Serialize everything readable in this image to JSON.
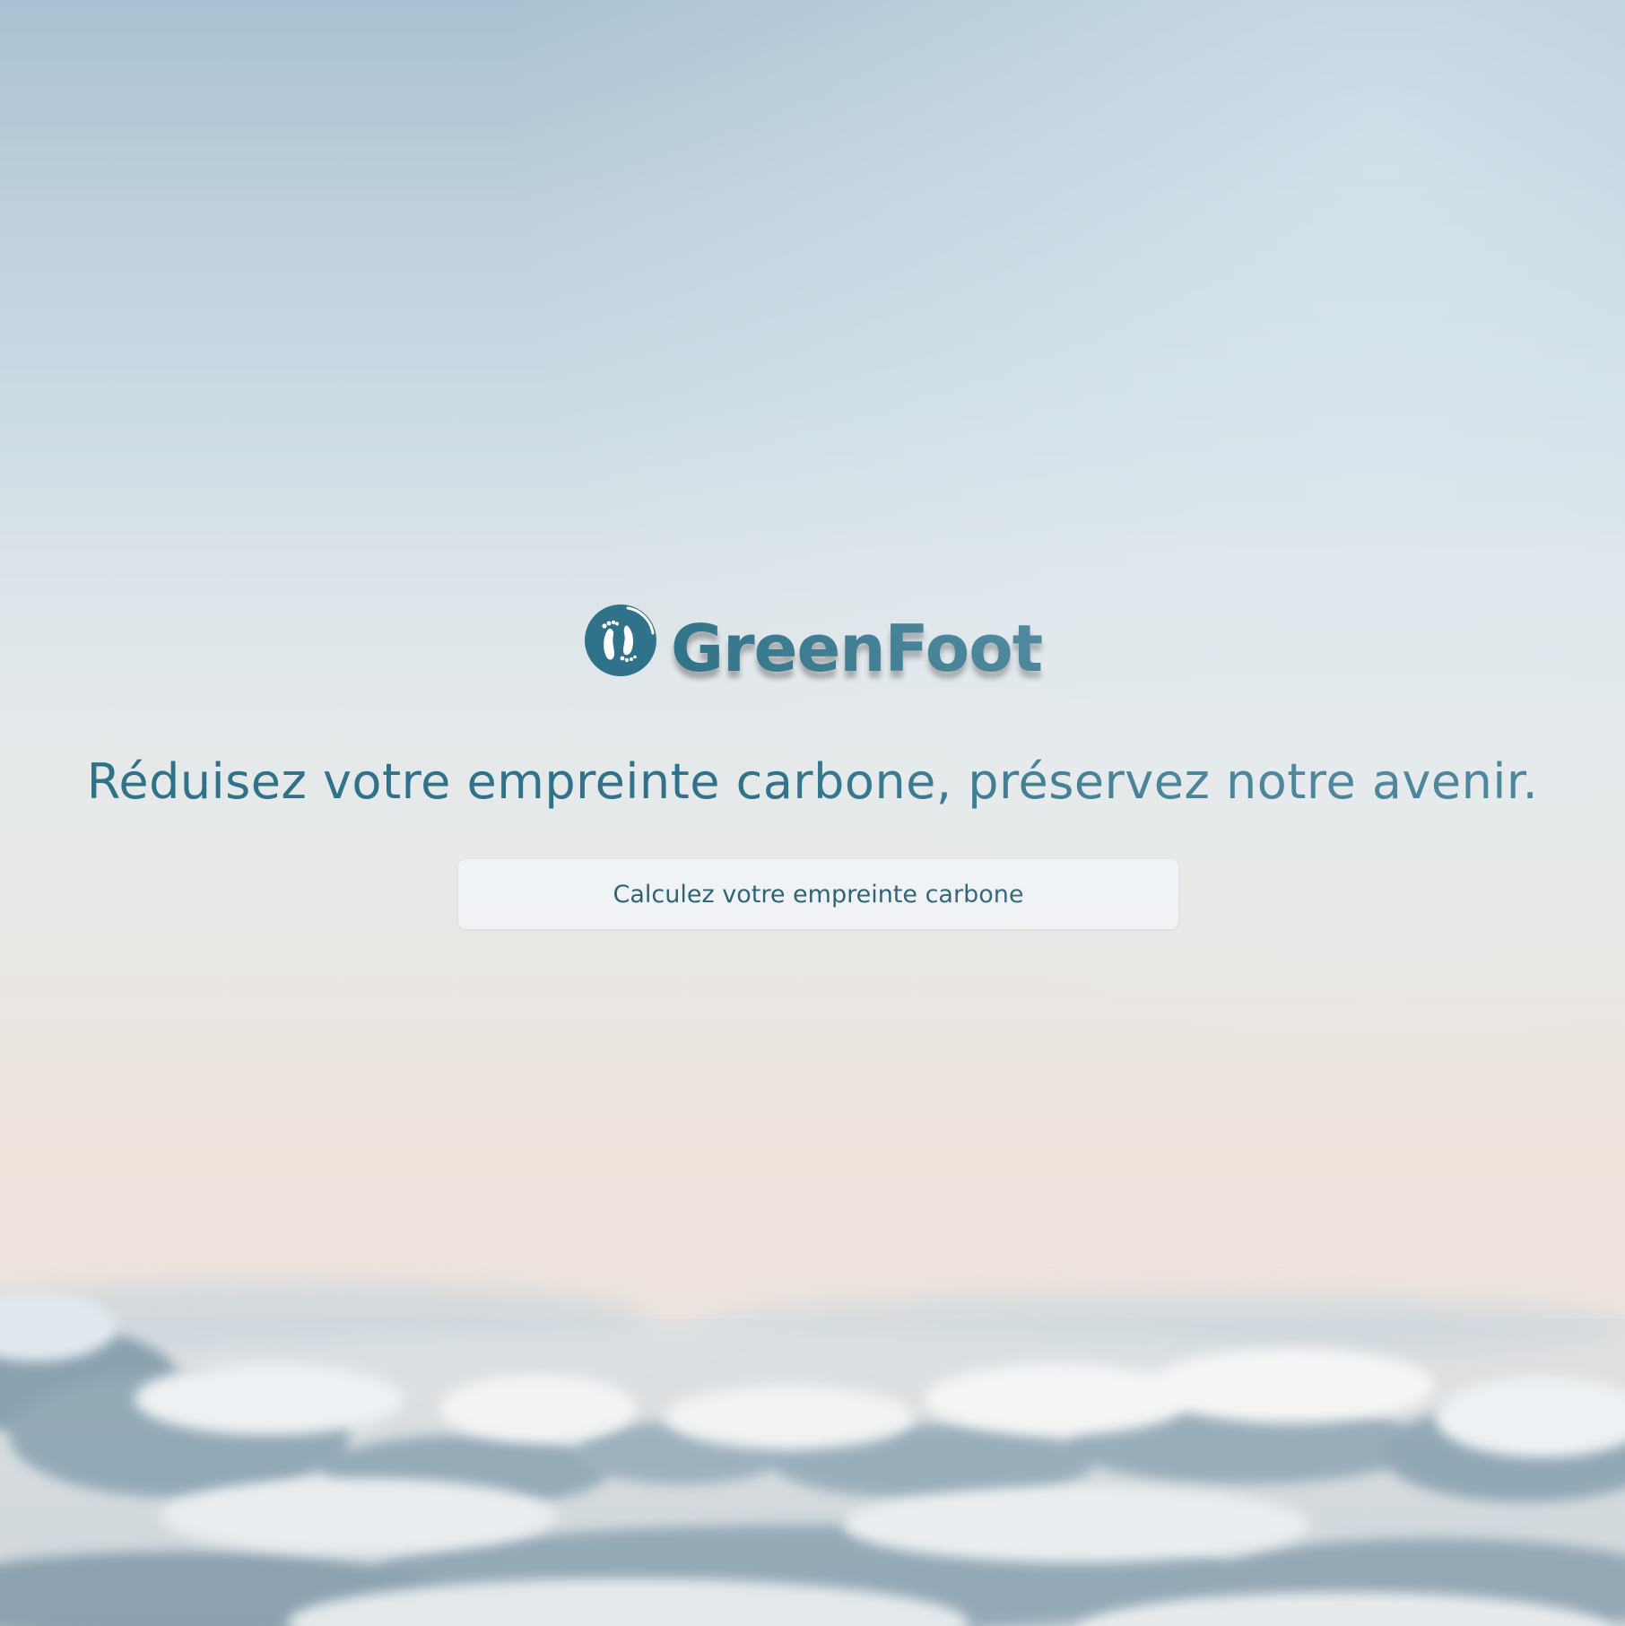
{
  "brand": {
    "name": "GreenFoot",
    "logo_icon": "footprints-icon",
    "color": "#2f7289"
  },
  "hero": {
    "tagline": "Réduisez votre empreinte carbone, préservez notre avenir.",
    "background": "sky-above-clouds"
  },
  "cta": {
    "label": "Calculez votre empreinte carbone"
  }
}
